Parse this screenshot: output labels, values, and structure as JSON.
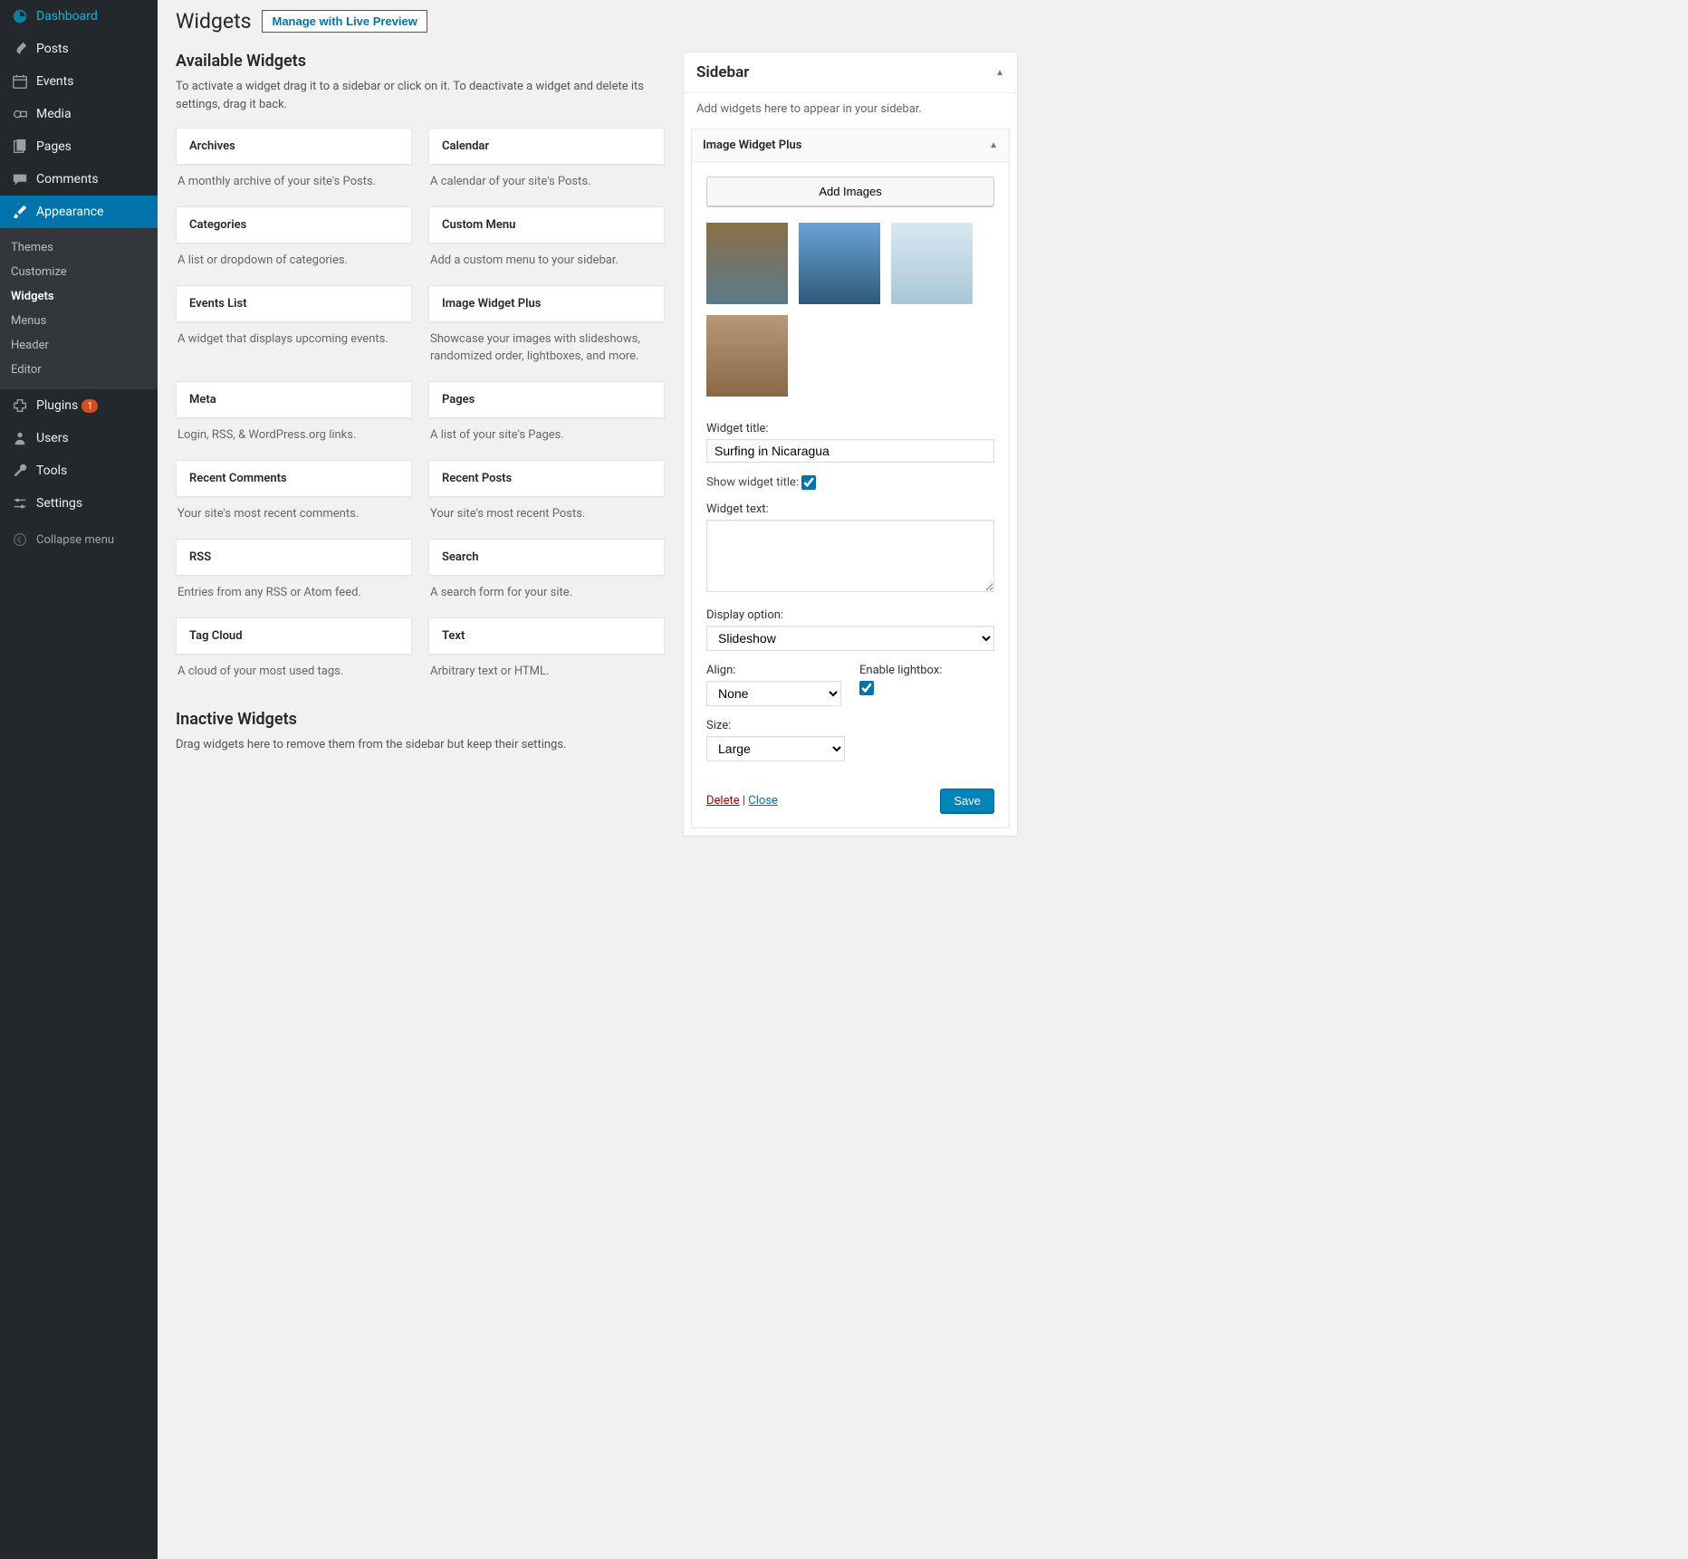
{
  "menu": {
    "dashboard": "Dashboard",
    "posts": "Posts",
    "events": "Events",
    "media": "Media",
    "pages": "Pages",
    "comments": "Comments",
    "appearance": "Appearance",
    "plugins": "Plugins",
    "plugins_badge": "1",
    "users": "Users",
    "tools": "Tools",
    "settings": "Settings",
    "collapse": "Collapse menu"
  },
  "submenu": {
    "themes": "Themes",
    "customize": "Customize",
    "widgets": "Widgets",
    "menus": "Menus",
    "header": "Header",
    "editor": "Editor"
  },
  "header": {
    "title": "Widgets",
    "preview_btn": "Manage with Live Preview"
  },
  "available": {
    "title": "Available Widgets",
    "desc": "To activate a widget drag it to a sidebar or click on it. To deactivate a widget and delete its settings, drag it back.",
    "items": [
      {
        "title": "Archives",
        "desc": "A monthly archive of your site's Posts."
      },
      {
        "title": "Calendar",
        "desc": "A calendar of your site's Posts."
      },
      {
        "title": "Categories",
        "desc": "A list or dropdown of categories."
      },
      {
        "title": "Custom Menu",
        "desc": "Add a custom menu to your sidebar."
      },
      {
        "title": "Events List",
        "desc": "A widget that displays upcoming events."
      },
      {
        "title": "Image Widget Plus",
        "desc": "Showcase your images with slideshows, randomized order, lightboxes, and more."
      },
      {
        "title": "Meta",
        "desc": "Login, RSS, & WordPress.org links."
      },
      {
        "title": "Pages",
        "desc": "A list of your site's Pages."
      },
      {
        "title": "Recent Comments",
        "desc": "Your site's most recent comments."
      },
      {
        "title": "Recent Posts",
        "desc": "Your site's most recent Posts."
      },
      {
        "title": "RSS",
        "desc": "Entries from any RSS or Atom feed."
      },
      {
        "title": "Search",
        "desc": "A search form for your site."
      },
      {
        "title": "Tag Cloud",
        "desc": "A cloud of your most used tags."
      },
      {
        "title": "Text",
        "desc": "Arbitrary text or HTML."
      }
    ]
  },
  "inactive": {
    "title": "Inactive Widgets",
    "desc": "Drag widgets here to remove them from the sidebar but keep their settings."
  },
  "sidebar": {
    "title": "Sidebar",
    "desc": "Add widgets here to appear in your sidebar.",
    "widget_name": "Image Widget Plus",
    "add_images": "Add Images",
    "widget_title_label": "Widget title:",
    "widget_title_value": "Surfing in Nicaragua",
    "show_title_label": "Show widget title:",
    "show_title_checked": true,
    "widget_text_label": "Widget text:",
    "widget_text_value": "",
    "display_label": "Display option:",
    "display_value": "Slideshow",
    "align_label": "Align:",
    "align_value": "None",
    "lightbox_label": "Enable lightbox:",
    "lightbox_checked": true,
    "size_label": "Size:",
    "size_value": "Large",
    "delete": "Delete",
    "close": "Close",
    "save": "Save",
    "separator": " | "
  }
}
